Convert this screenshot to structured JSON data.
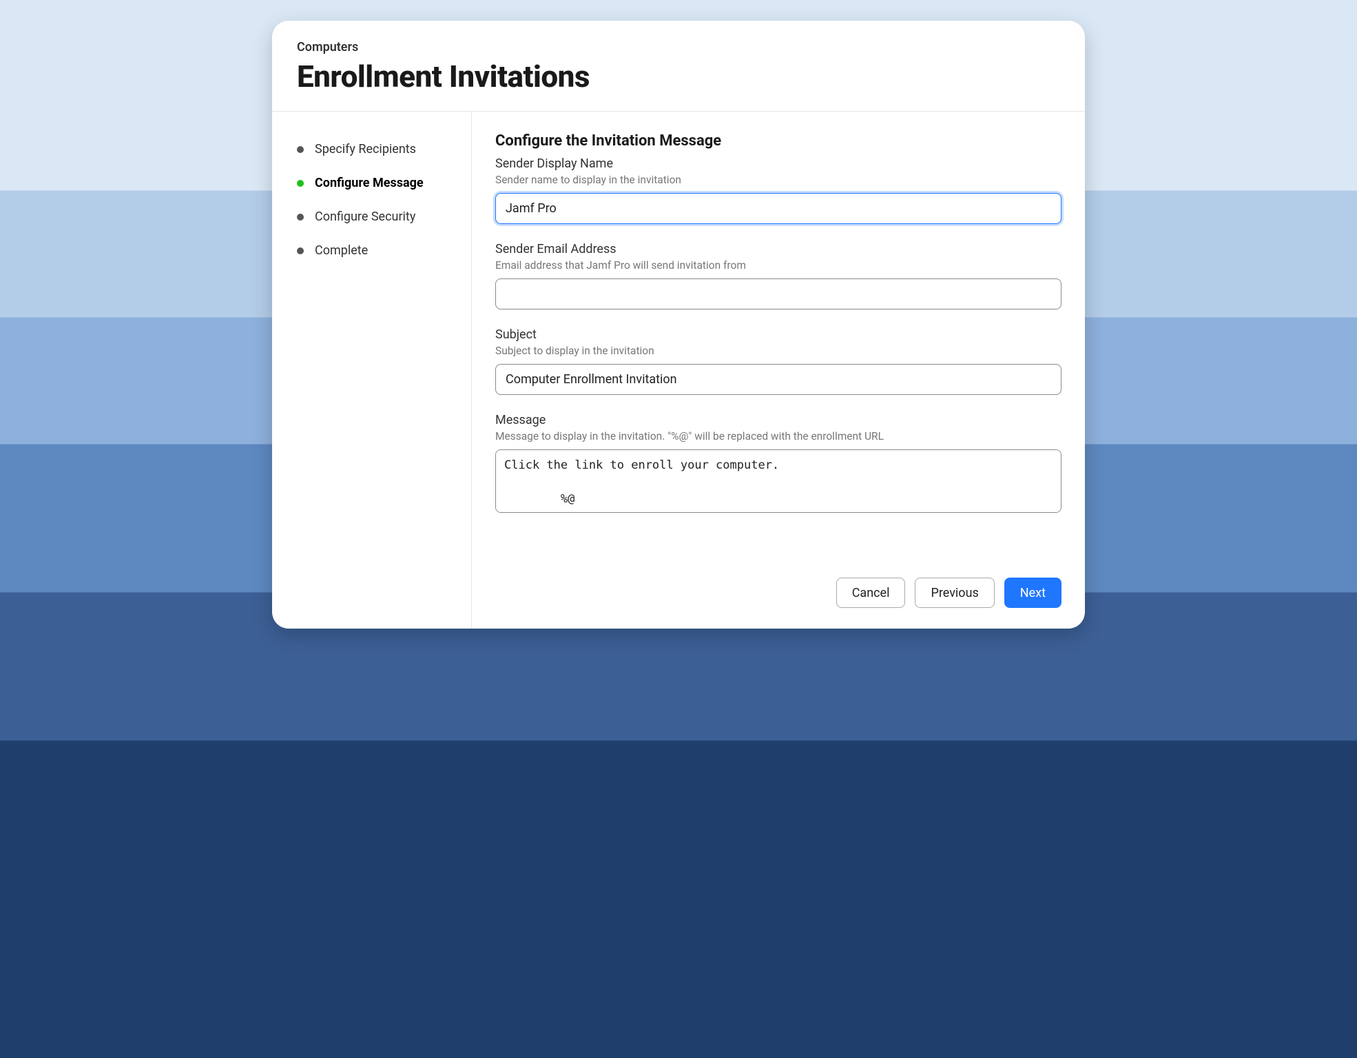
{
  "header": {
    "breadcrumb": "Computers",
    "title": "Enrollment Invitations"
  },
  "sidebar": {
    "steps": [
      {
        "label": "Specify Recipients",
        "active": false
      },
      {
        "label": "Configure Message",
        "active": true
      },
      {
        "label": "Configure Security",
        "active": false
      },
      {
        "label": "Complete",
        "active": false
      }
    ]
  },
  "main": {
    "section_title": "Configure the Invitation Message",
    "fields": {
      "sender_name": {
        "label": "Sender Display Name",
        "help": "Sender name to display in the invitation",
        "value": "Jamf Pro"
      },
      "sender_email": {
        "label": "Sender Email Address",
        "help": "Email address that Jamf Pro will send invitation from",
        "value": ""
      },
      "subject": {
        "label": "Subject",
        "help": "Subject to display in the invitation",
        "value": "Computer Enrollment Invitation"
      },
      "message": {
        "label": "Message",
        "help": "Message to display in the invitation. \"%@\" will be replaced with the enrollment URL",
        "value": "Click the link to enroll your computer.\n\n        %@"
      }
    }
  },
  "footer": {
    "cancel": "Cancel",
    "previous": "Previous",
    "next": "Next"
  }
}
